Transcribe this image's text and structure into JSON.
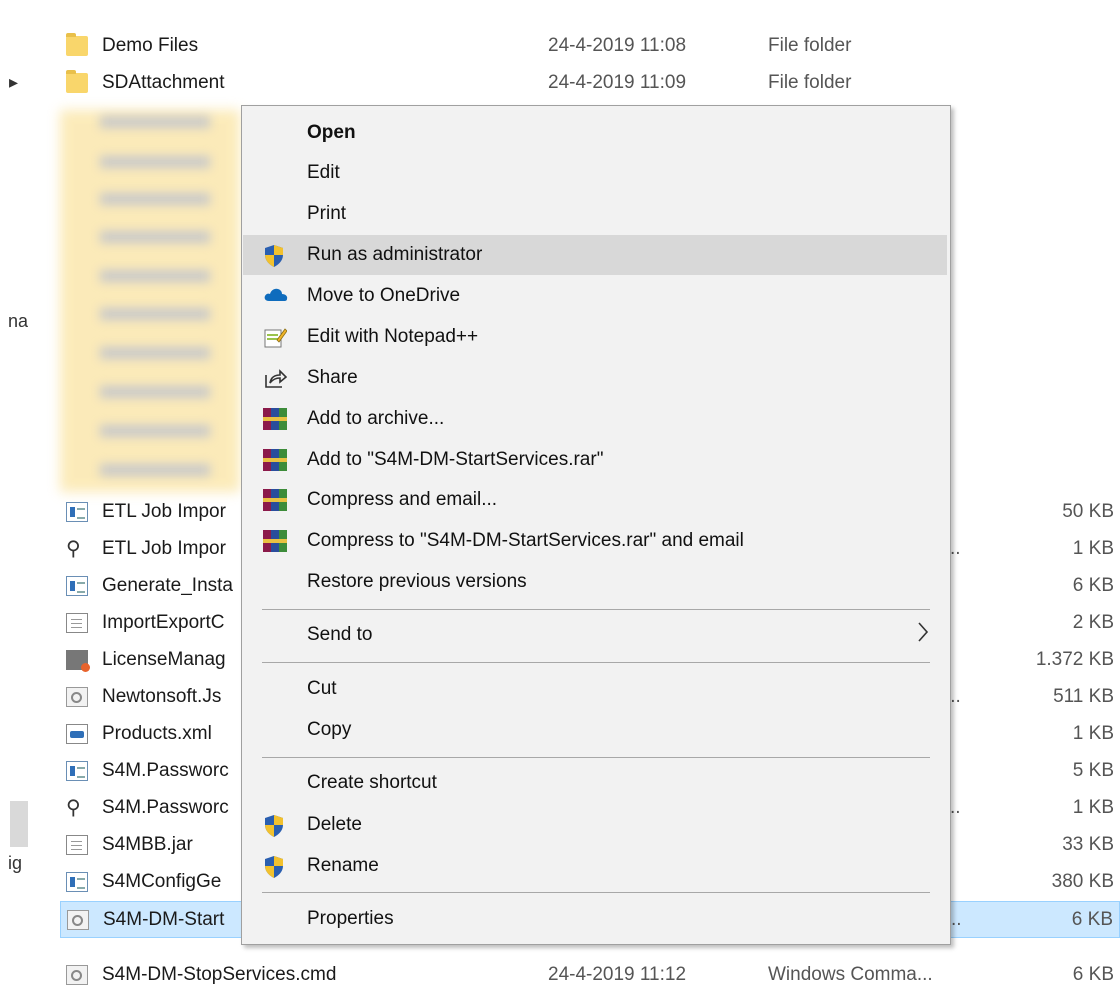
{
  "nav": {
    "fragments": [
      "na",
      "ig"
    ]
  },
  "files": {
    "rows": [
      {
        "name": "Demo Files",
        "date": "24-4-2019 11:08",
        "type": "File folder",
        "size": "",
        "icon": "folder-icon"
      },
      {
        "name": "SDAttachment",
        "date": "24-4-2019 11:09",
        "type": "File folder",
        "size": "",
        "icon": "folder-icon"
      },
      {
        "name": "ETL Job Impor",
        "date": "",
        "type": "",
        "size": "50 KB",
        "icon": "application-icon"
      },
      {
        "name": "ETL Job Impor",
        "date": "",
        "type": "..",
        "size": "1 KB",
        "icon": "config-file-icon"
      },
      {
        "name": "Generate_Insta",
        "date": "",
        "type": "",
        "size": "6 KB",
        "icon": "application-icon"
      },
      {
        "name": "ImportExportC",
        "date": "",
        "type": "",
        "size": "2 KB",
        "icon": "text-document-icon"
      },
      {
        "name": "LicenseManag",
        "date": "",
        "type": "",
        "size": "1.372 KB",
        "icon": "license-icon"
      },
      {
        "name": "Newtonsoft.Js",
        "date": "",
        "type": "...",
        "size": "511 KB",
        "icon": "library-icon"
      },
      {
        "name": "Products.xml",
        "date": "",
        "type": "",
        "size": "1 KB",
        "icon": "xml-file-icon"
      },
      {
        "name": "S4M.Passworc",
        "date": "",
        "type": "",
        "size": "5 KB",
        "icon": "application-icon"
      },
      {
        "name": "S4M.Passworc",
        "date": "",
        "type": "..",
        "size": "1 KB",
        "icon": "config-file-icon"
      },
      {
        "name": "S4MBB.jar",
        "date": "",
        "type": "",
        "size": "33 KB",
        "icon": "file-icon"
      },
      {
        "name": "S4MConfigGe",
        "date": "",
        "type": "",
        "size": "380 KB",
        "icon": "application-icon"
      },
      {
        "name": "S4M-DM-Start",
        "date": "",
        "type": "..",
        "size": "6 KB",
        "icon": "cmd-file-icon"
      },
      {
        "name": "S4M-DM-StopServices.cmd",
        "date": "24-4-2019 11:12",
        "type": "Windows Comma...",
        "size": "6 KB",
        "icon": "cmd-file-icon"
      }
    ]
  },
  "context_menu": {
    "items": [
      {
        "label": "Open",
        "icon": ""
      },
      {
        "label": "Edit",
        "icon": ""
      },
      {
        "label": "Print",
        "icon": ""
      },
      {
        "label": "Run as administrator",
        "icon": "uac-shield-icon"
      },
      {
        "label": "Move to OneDrive",
        "icon": "onedrive-cloud-icon"
      },
      {
        "label": "Edit with Notepad++",
        "icon": "notepadpp-icon"
      },
      {
        "label": "Share",
        "icon": "share-icon"
      },
      {
        "label": "Add to archive...",
        "icon": "winrar-icon"
      },
      {
        "label": "Add to \"S4M-DM-StartServices.rar\"",
        "icon": "winrar-icon"
      },
      {
        "label": "Compress and email...",
        "icon": "winrar-icon"
      },
      {
        "label": "Compress to \"S4M-DM-StartServices.rar\" and email",
        "icon": "winrar-icon"
      },
      {
        "label": "Restore previous versions",
        "icon": ""
      },
      {
        "label": "Send to",
        "icon": "chevron-right-icon"
      },
      {
        "label": "Cut",
        "icon": ""
      },
      {
        "label": "Copy",
        "icon": ""
      },
      {
        "label": "Create shortcut",
        "icon": ""
      },
      {
        "label": "Delete",
        "icon": "uac-shield-icon"
      },
      {
        "label": "Rename",
        "icon": "uac-shield-icon"
      },
      {
        "label": "Properties",
        "icon": ""
      }
    ],
    "send_to_arrow": ">"
  },
  "colors": {
    "selection": "#cce8ff",
    "menu_bg": "#f2f2f2",
    "menu_hover": "#d8d8d8",
    "folder": "#f9d66b",
    "shield_blue": "#2a5fb0",
    "shield_yellow": "#f2c12e",
    "onedrive": "#0f6cbd"
  }
}
